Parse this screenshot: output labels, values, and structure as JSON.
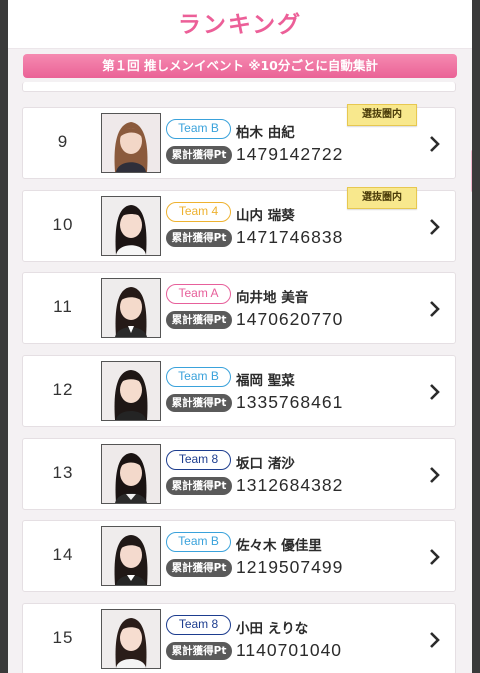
{
  "header": {
    "title": "ランキング"
  },
  "banner": {
    "text": "第１回 推しメンイベント ※10分ごとに自動集計"
  },
  "labels": {
    "points": "累計獲得Pt",
    "selection": "選抜圏内"
  },
  "colors": {
    "team_b": "#3aa2db",
    "team_4": "#eeb230",
    "team_a": "#e7609b",
    "team_8": "#1d3d8f"
  },
  "entries": [
    {
      "rank": "9",
      "team": "Team B",
      "name": "柏木 由紀",
      "points": "1479142722",
      "selected": true
    },
    {
      "rank": "10",
      "team": "Team 4",
      "name": "山内 瑞葵",
      "points": "1471746838",
      "selected": true
    },
    {
      "rank": "11",
      "team": "Team A",
      "name": "向井地 美音",
      "points": "1470620770",
      "selected": false
    },
    {
      "rank": "12",
      "team": "Team B",
      "name": "福岡 聖菜",
      "points": "1335768461",
      "selected": false
    },
    {
      "rank": "13",
      "team": "Team 8",
      "name": "坂口 渚沙",
      "points": "1312684382",
      "selected": false
    },
    {
      "rank": "14",
      "team": "Team B",
      "name": "佐々木 優佳里",
      "points": "1219507499",
      "selected": false
    },
    {
      "rank": "15",
      "team": "Team 8",
      "name": "小田 えりな",
      "points": "1140701040",
      "selected": false
    }
  ]
}
